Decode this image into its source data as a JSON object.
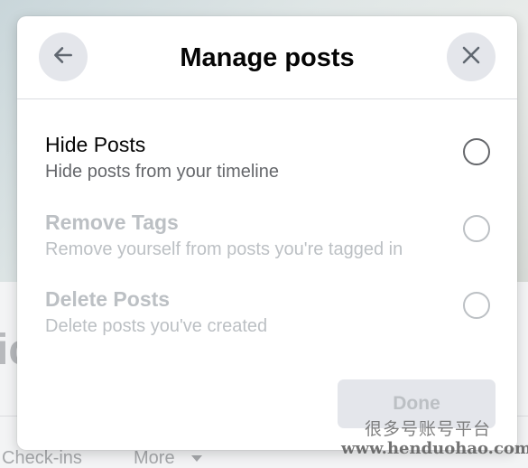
{
  "background": {
    "name_fragment": "ic",
    "tabs": [
      "Check-ins",
      "More"
    ]
  },
  "modal": {
    "title": "Manage posts",
    "back_icon": "arrow-left-icon",
    "close_icon": "close-icon",
    "options": [
      {
        "title": "Hide Posts",
        "description": "Hide posts from your timeline",
        "state": "enabled",
        "selected": false
      },
      {
        "title": "Remove Tags",
        "description": "Remove yourself from posts you're tagged in",
        "state": "disabled",
        "selected": false
      },
      {
        "title": "Delete Posts",
        "description": "Delete posts you've created",
        "state": "disabled",
        "selected": false
      }
    ],
    "done_label": "Done"
  },
  "watermark": {
    "text": "很多号账号平台",
    "url": "www.henduohao.com"
  },
  "colors": {
    "primary_text": "#050505",
    "secondary_text": "#65676b",
    "disabled_text": "#bcc0c4",
    "button_bg": "#e4e6eb"
  }
}
